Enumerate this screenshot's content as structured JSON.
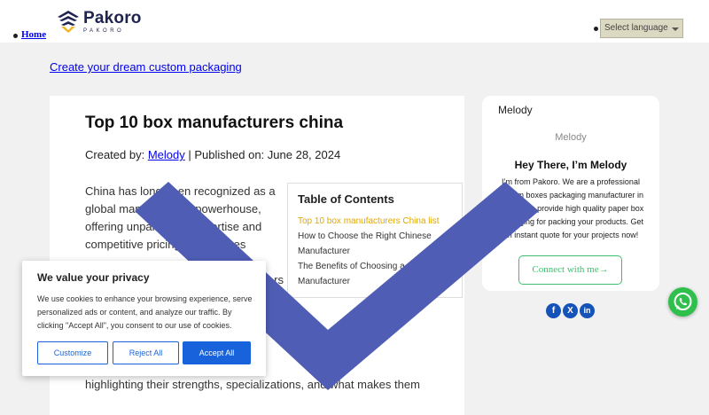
{
  "header": {
    "logo_name": "Pakoro",
    "logo_sub": "PAKORO",
    "nav_home": "Home",
    "language_select": "Select language"
  },
  "tagline": "Create your dream custom packaging",
  "article": {
    "title": "Top 10 box manufacturers china",
    "meta_created_by": "Created by:",
    "meta_author": "Melody",
    "meta_separator": "|",
    "meta_published": "Published on: June 28, 2024",
    "body_lines": [
      "China has long been recognized as a",
      "global manufacturing powerhouse,",
      "offering unparalleled expertise and",
      "competitive pricing. Businesses",
      "",
      "rs"
    ],
    "bottom_line": "highlighting their strengths, specializations, and what makes them"
  },
  "toc": {
    "title": "Table of Contents",
    "items": [
      "Top 10 box manufacturers China list",
      "How to Choose the Right Chinese",
      "Manufacturer",
      "The Benefits of Choosing a Chinese",
      "Manufacturer"
    ]
  },
  "author_card": {
    "name": "Melody",
    "image_alt": "Melody",
    "greeting": "Hey There, I’m Melody",
    "bio": "I’m from Pakoro. We are a professional custom boxes packaging manufacturer in China. We provide high quality paper box packaging for packing your products. Get an instant quote for your projects now!",
    "connect_button": "Connect with me→"
  },
  "social_icons": [
    "facebook-icon",
    "x-icon",
    "linkedin-icon"
  ],
  "cookie": {
    "title": "We value your privacy",
    "text": "We use cookies to enhance your browsing experience, serve personalized ads or content, and analyze our traffic. By clicking \"Accept All\", you consent to our use of cookies.",
    "customize": "Customize",
    "reject": "Reject All",
    "accept": "Accept All"
  },
  "colors": {
    "accent_blue": "#1863dc",
    "toc_active": "#e0a800",
    "connect_green": "#3cc06f",
    "checkmark": "#4f5db5"
  }
}
